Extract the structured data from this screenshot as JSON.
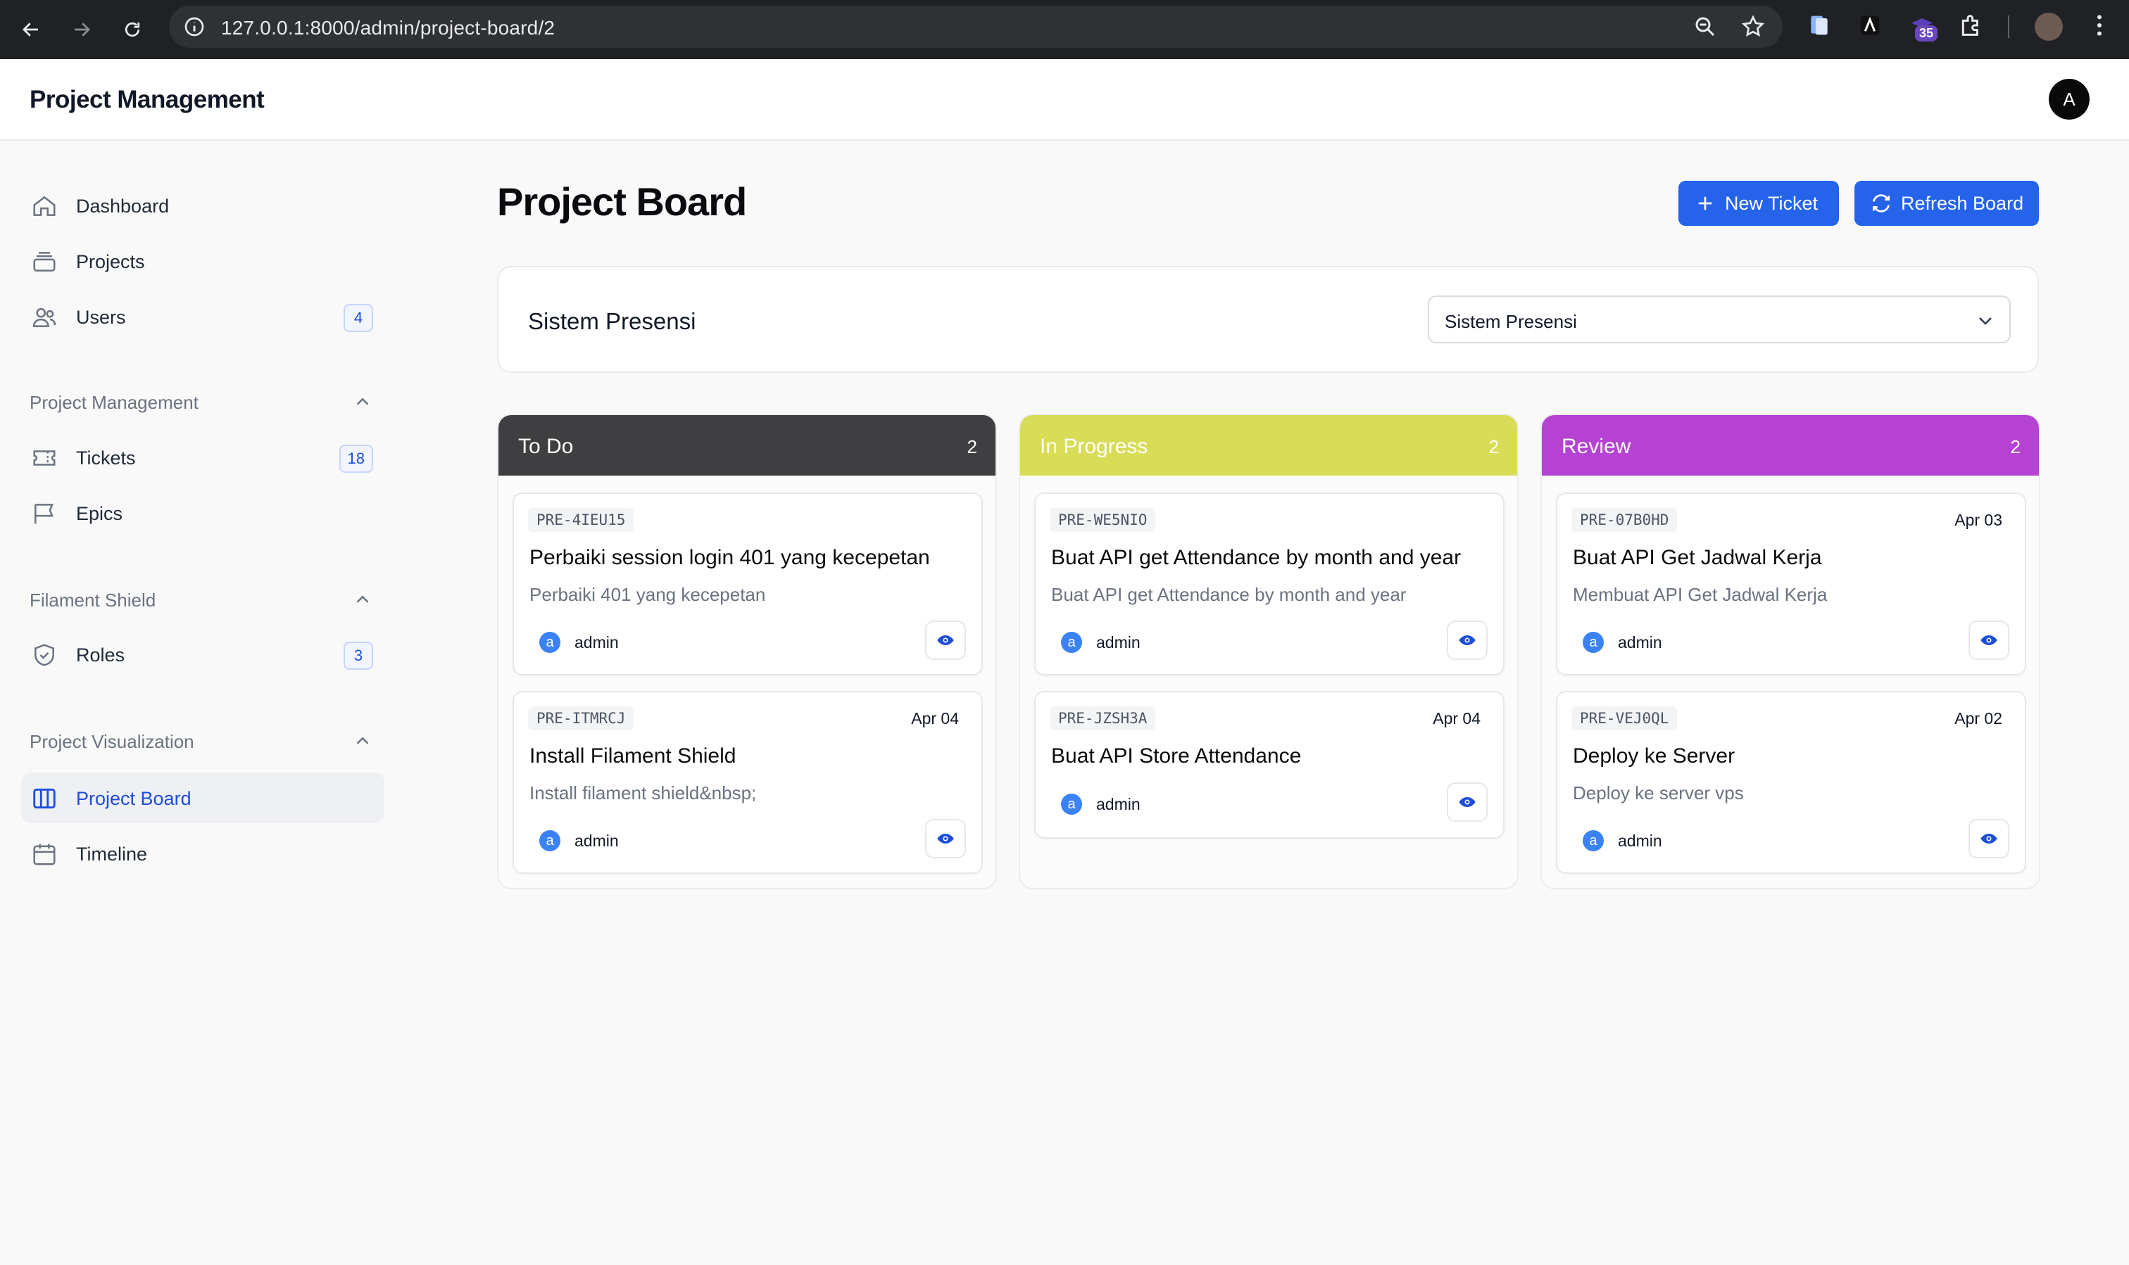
{
  "browser": {
    "url": "127.0.0.1:8000/admin/project-board/2",
    "extension_badge": "35"
  },
  "header": {
    "brand": "Project Management",
    "avatar_initial": "A"
  },
  "sidebar": {
    "items": [
      {
        "label": "Dashboard",
        "icon": "home-icon"
      },
      {
        "label": "Projects",
        "icon": "stack-icon"
      },
      {
        "label": "Users",
        "icon": "users-icon",
        "badge": "4"
      }
    ],
    "groups": [
      {
        "title": "Project Management",
        "items": [
          {
            "label": "Tickets",
            "icon": "ticket-icon",
            "badge": "18"
          },
          {
            "label": "Epics",
            "icon": "flag-icon"
          }
        ]
      },
      {
        "title": "Filament Shield",
        "items": [
          {
            "label": "Roles",
            "icon": "shield-icon",
            "badge": "3"
          }
        ]
      },
      {
        "title": "Project Visualization",
        "items": [
          {
            "label": "Project Board",
            "icon": "columns-icon",
            "active": true
          },
          {
            "label": "Timeline",
            "icon": "calendar-icon"
          }
        ]
      }
    ]
  },
  "main": {
    "title": "Project Board",
    "new_ticket_label": "New Ticket",
    "refresh_label": "Refresh Board",
    "project_name": "Sistem Presensi",
    "project_select_value": "Sistem Presensi"
  },
  "colors": {
    "primary": "#2563eb",
    "todo": "#3f3f42",
    "in_progress": "#d9dc57",
    "review": "#b542d2"
  },
  "columns": [
    {
      "title": "To Do",
      "count": "2",
      "cards": [
        {
          "code": "PRE-4IEU15",
          "date": "",
          "title": "Perbaiki session login 401 yang kecepetan",
          "desc": "Perbaiki 401 yang kecepetan",
          "user_initial": "a",
          "user": "admin"
        },
        {
          "code": "PRE-ITMRCJ",
          "date": "Apr 04",
          "title": "Install Filament Shield",
          "desc": "Install filament shield&nbsp;",
          "user_initial": "a",
          "user": "admin"
        }
      ]
    },
    {
      "title": "In Progress",
      "count": "2",
      "cards": [
        {
          "code": "PRE-WE5NIO",
          "date": "",
          "title": "Buat API get Attendance by month and year",
          "desc": "Buat API get Attendance by month and year",
          "user_initial": "a",
          "user": "admin"
        },
        {
          "code": "PRE-JZSH3A",
          "date": "Apr 04",
          "title": "Buat API Store Attendance",
          "desc": "",
          "user_initial": "a",
          "user": "admin"
        }
      ]
    },
    {
      "title": "Review",
      "count": "2",
      "cards": [
        {
          "code": "PRE-07B0HD",
          "date": "Apr 03",
          "title": "Buat API Get Jadwal Kerja",
          "desc": "Membuat API Get Jadwal Kerja",
          "user_initial": "a",
          "user": "admin"
        },
        {
          "code": "PRE-VEJ0QL",
          "date": "Apr 02",
          "title": "Deploy ke Server",
          "desc": "Deploy ke server vps",
          "user_initial": "a",
          "user": "admin"
        }
      ]
    }
  ]
}
